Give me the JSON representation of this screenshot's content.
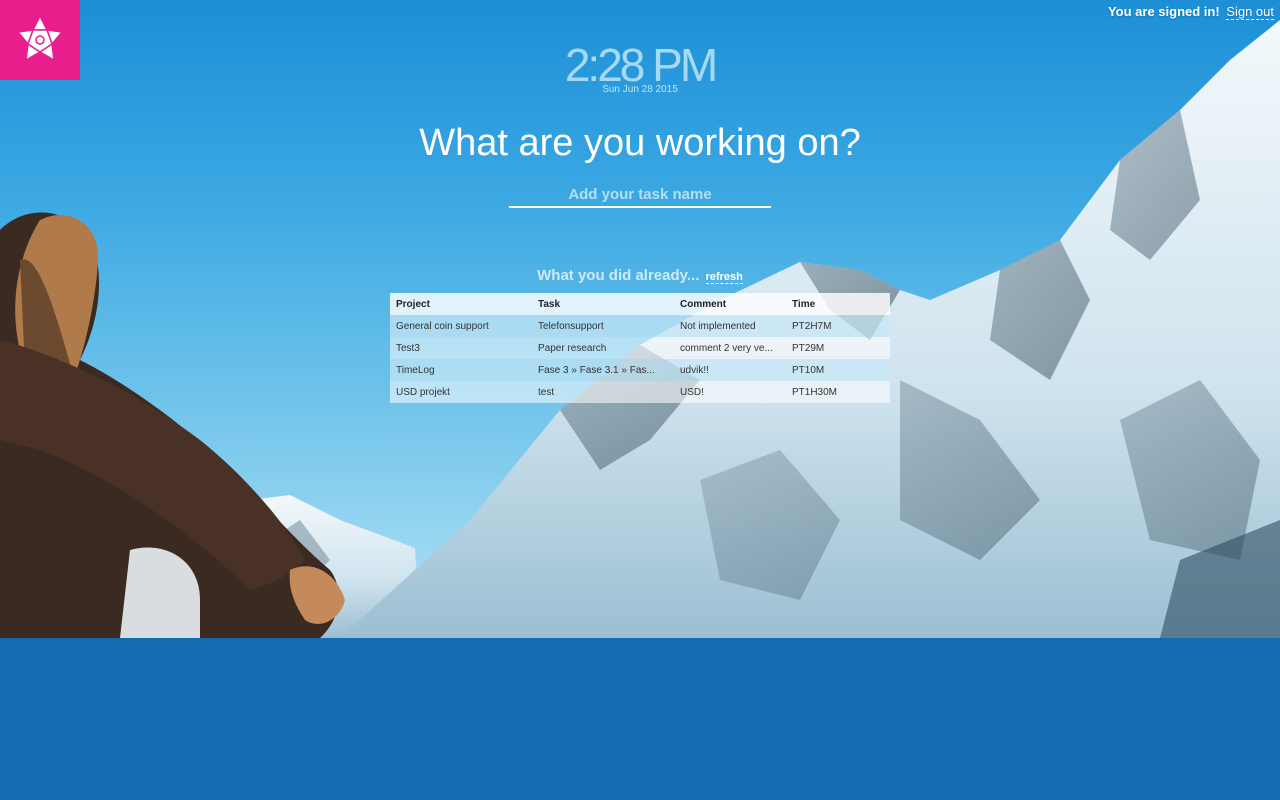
{
  "header": {
    "signed_in_text": "You are signed in!",
    "sign_out_label": "Sign out",
    "logo_icon": "flower-logo-icon",
    "logo_color": "#e91e8c"
  },
  "clock": {
    "time": "2:28 PM",
    "date": "Sun Jun 28 2015"
  },
  "main": {
    "question": "What are you working on?",
    "task_placeholder": "Add your task name"
  },
  "history": {
    "heading": "What you did already...",
    "refresh_label": "refresh",
    "columns": [
      "Project",
      "Task",
      "Comment",
      "Time"
    ],
    "rows": [
      [
        "General coin support",
        "Telefonsupport",
        "Not implemented",
        "PT2H7M"
      ],
      [
        "Test3",
        "Paper research",
        "comment 2 very ve...",
        "PT29M"
      ],
      [
        "TimeLog",
        "Fase 3 » Fase 3.1 » Fas...",
        "udvik!!",
        "PT10M"
      ],
      [
        "USD projekt",
        "test",
        "USD!",
        "PT1H30M"
      ]
    ]
  },
  "colors": {
    "bottom_background": "#136cb0",
    "sky": "#3aa7e2"
  }
}
